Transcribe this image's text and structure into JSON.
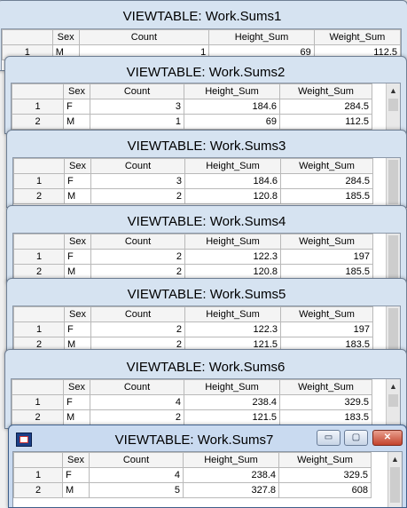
{
  "columns": [
    "Sex",
    "Count",
    "Height_Sum",
    "Weight_Sum"
  ],
  "windows": [
    {
      "title": "VIEWTABLE: Work.Sums1",
      "rows": [
        {
          "n": "1",
          "sex": "M",
          "count": "1",
          "height": "69",
          "weight": "112.5"
        }
      ]
    },
    {
      "title": "VIEWTABLE: Work.Sums2",
      "rows": [
        {
          "n": "1",
          "sex": "F",
          "count": "3",
          "height": "184.6",
          "weight": "284.5"
        },
        {
          "n": "2",
          "sex": "M",
          "count": "1",
          "height": "69",
          "weight": "112.5"
        }
      ]
    },
    {
      "title": "VIEWTABLE: Work.Sums3",
      "rows": [
        {
          "n": "1",
          "sex": "F",
          "count": "3",
          "height": "184.6",
          "weight": "284.5"
        },
        {
          "n": "2",
          "sex": "M",
          "count": "2",
          "height": "120.8",
          "weight": "185.5"
        }
      ]
    },
    {
      "title": "VIEWTABLE: Work.Sums4",
      "rows": [
        {
          "n": "1",
          "sex": "F",
          "count": "2",
          "height": "122.3",
          "weight": "197"
        },
        {
          "n": "2",
          "sex": "M",
          "count": "2",
          "height": "120.8",
          "weight": "185.5"
        }
      ]
    },
    {
      "title": "VIEWTABLE: Work.Sums5",
      "rows": [
        {
          "n": "1",
          "sex": "F",
          "count": "2",
          "height": "122.3",
          "weight": "197"
        },
        {
          "n": "2",
          "sex": "M",
          "count": "2",
          "height": "121.5",
          "weight": "183.5"
        }
      ]
    },
    {
      "title": "VIEWTABLE: Work.Sums6",
      "rows": [
        {
          "n": "1",
          "sex": "F",
          "count": "4",
          "height": "238.4",
          "weight": "329.5"
        },
        {
          "n": "2",
          "sex": "M",
          "count": "2",
          "height": "121.5",
          "weight": "183.5"
        }
      ]
    },
    {
      "title": "VIEWTABLE: Work.Sums7",
      "rows": [
        {
          "n": "1",
          "sex": "F",
          "count": "4",
          "height": "238.4",
          "weight": "329.5"
        },
        {
          "n": "2",
          "sex": "M",
          "count": "5",
          "height": "327.8",
          "weight": "608"
        }
      ]
    }
  ],
  "window_controls": {
    "minimize": "▭",
    "maximize": "▢",
    "close": "✕"
  },
  "scroll_up_glyph": "▲",
  "icons": {
    "system_menu": "sas-viewtable-icon",
    "scroll_up": "chevron-up-icon"
  },
  "colors": {
    "frame": "#d6e3f1",
    "active_frame": "#c9daf0",
    "close_button": "#c3432c"
  }
}
